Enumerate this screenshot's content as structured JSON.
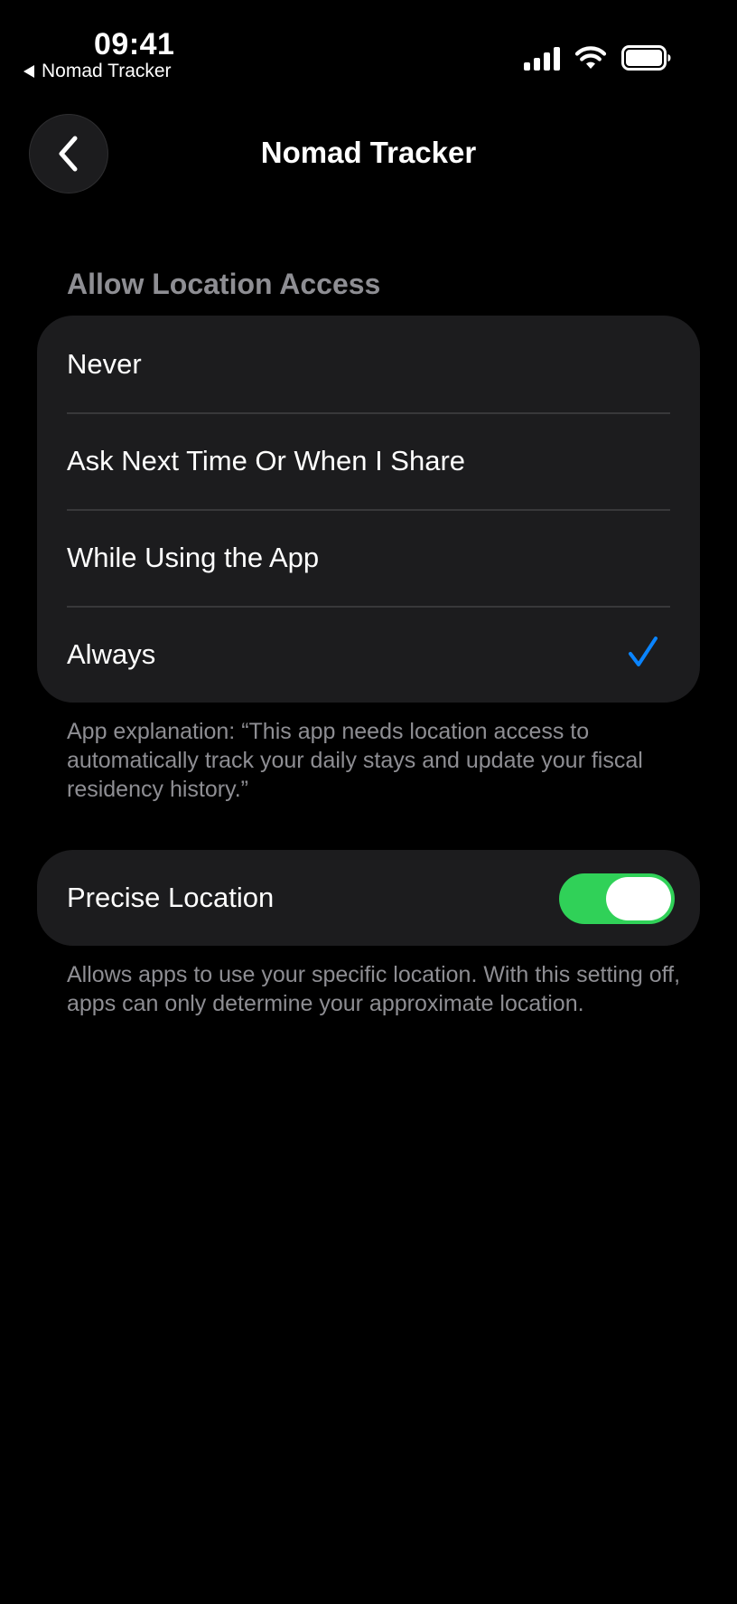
{
  "status_bar": {
    "time": "09:41",
    "return_app": "Nomad Tracker",
    "icons": [
      "cellular-signal-icon",
      "wifi-icon",
      "battery-icon"
    ]
  },
  "nav": {
    "title": "Nomad Tracker",
    "back_icon": "chevron-left-icon"
  },
  "location_access": {
    "header": "Allow Location Access",
    "options": [
      {
        "label": "Never",
        "selected": false
      },
      {
        "label": "Ask Next Time Or When I Share",
        "selected": false
      },
      {
        "label": "While Using the App",
        "selected": false
      },
      {
        "label": "Always",
        "selected": true
      }
    ],
    "explanation": "App explanation: “This app needs location access to automatically track your daily stays and update your fiscal residency history.”"
  },
  "precise_location": {
    "label": "Precise Location",
    "enabled": true,
    "footnote": "Allows apps to use your specific location. With this setting off, apps can only determine your approximate location."
  },
  "colors": {
    "background": "#000000",
    "group_background": "#1c1c1e",
    "secondary_text": "#8e8e93",
    "checkmark": "#0a84ff",
    "toggle_on": "#30d158"
  }
}
